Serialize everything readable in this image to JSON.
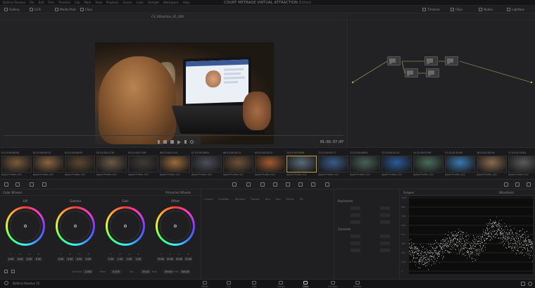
{
  "window": {
    "title": "COURT METRAGE VIRTUAL ATTRACTION",
    "title_suffix": "Edited"
  },
  "menu": [
    "DaVinci Resolve",
    "File",
    "Edit",
    "Trim",
    "Timeline",
    "Clip",
    "Mark",
    "View",
    "Playback",
    "Fusion",
    "Color",
    "Fairlight",
    "Workspace",
    "Help"
  ],
  "toolbar": {
    "left": [
      {
        "icon": "gallery-icon",
        "label": "Gallery"
      },
      {
        "icon": "luts-icon",
        "label": "LUTs"
      },
      {
        "icon": "media-pool-icon",
        "label": "Media Pool"
      },
      {
        "icon": "clips-icon",
        "label": "Clips"
      }
    ],
    "right": [
      {
        "icon": "timeline-icon",
        "label": "Timeline"
      },
      {
        "icon": "clips-icon",
        "label": "Clips"
      },
      {
        "icon": "nodes-icon",
        "label": "Nodes"
      },
      {
        "icon": "lightbox-icon",
        "label": "Lightbox"
      }
    ]
  },
  "viewer": {
    "clip_name": "CV_Attraction_01_004",
    "timecode": "01:02:37:07"
  },
  "nodes": [
    {
      "label": "01"
    },
    {
      "label": "02"
    },
    {
      "label": "03"
    },
    {
      "label": "04"
    },
    {
      "label": "05"
    }
  ],
  "clips": [
    {
      "num": "01",
      "tc": "01:00:00:00",
      "name": "Apple ProRes 422",
      "color": "#7a5a3a"
    },
    {
      "num": "02",
      "tc": "01:00:04:12",
      "name": "Apple ProRes 422",
      "color": "#8a6440"
    },
    {
      "num": "03",
      "tc": "01:00:09:03",
      "name": "Apple ProRes 422",
      "color": "#5a4530"
    },
    {
      "num": "04",
      "tc": "01:00:12:20",
      "name": "Apple ProRes 422",
      "color": "#6a5846"
    },
    {
      "num": "05",
      "tc": "01:00:17:08",
      "name": "Apple ProRes 422",
      "color": "#3e3a36"
    },
    {
      "num": "06",
      "tc": "01:00:21:15",
      "name": "Apple ProRes 422",
      "color": "#9a6a3c"
    },
    {
      "num": "07",
      "tc": "01:00:26:01",
      "name": "Apple ProRes 422",
      "color": "#4a4e58"
    },
    {
      "num": "08",
      "tc": "01:00:30:11",
      "name": "Apple ProRes 422",
      "color": "#6e5038"
    },
    {
      "num": "09",
      "tc": "01:00:34:22",
      "name": "Apple ProRes 422",
      "color": "#a05a30"
    },
    {
      "num": "10",
      "tc": "01:00:39:06",
      "name": "Apple ProRes 422",
      "color": "#5a6a7a"
    },
    {
      "num": "11",
      "tc": "01:00:43:17",
      "name": "Apple ProRes 422",
      "color": "#3a5a8a"
    },
    {
      "num": "12",
      "tc": "01:00:48:02",
      "name": "Apple ProRes 422",
      "color": "#486058"
    },
    {
      "num": "13",
      "tc": "01:00:52:14",
      "name": "Apple ProRes 422",
      "color": "#2a5a9a"
    },
    {
      "num": "14",
      "tc": "01:00:57:00",
      "name": "Apple ProRes 422",
      "color": "#4a6a5a"
    },
    {
      "num": "15",
      "tc": "01:01:01:09",
      "name": "Apple ProRes 422",
      "color": "#3a7ab0"
    },
    {
      "num": "16",
      "tc": "01:01:05:19",
      "name": "Apple ProRes 422",
      "color": "#8a6a50"
    },
    {
      "num": "17",
      "tc": "01:01:10:04",
      "name": "Apple ProRes 422",
      "color": "#5a5a5a"
    }
  ],
  "color_panel": {
    "title": "Color Wheels",
    "mode": "Primaries Wheels"
  },
  "wheels": [
    {
      "name": "Lift",
      "values": [
        "0.00",
        "0.00",
        "0.00",
        "0.00"
      ]
    },
    {
      "name": "Gamma",
      "values": [
        "0.00",
        "0.00",
        "0.00",
        "0.00"
      ]
    },
    {
      "name": "Gain",
      "values": [
        "1.00",
        "1.00",
        "1.00",
        "1.00"
      ]
    },
    {
      "name": "Offset",
      "values": [
        "25.00",
        "25.00",
        "25.00",
        "25.00"
      ]
    }
  ],
  "wheel_channels": [
    "Y",
    "R",
    "G",
    "B"
  ],
  "adjust": {
    "contrast_label": "Contrast",
    "contrast": "1.000",
    "pivot_label": "Pivot",
    "pivot": "0.435",
    "sat_label": "Sat",
    "sat": "50.00",
    "hue_label": "Hue",
    "hue": "50.00",
    "lum_label": "Lum Mix",
    "lum": "100.00"
  },
  "curves": {
    "tabs": [
      "Curves",
      "Qualifier",
      "Window",
      "Tracker",
      "Blur",
      "Key",
      "Sizing",
      "3D"
    ]
  },
  "keyframes": {
    "sections": [
      "Keyframes",
      "Corrector"
    ]
  },
  "scope": {
    "title": "Scopes",
    "mode": "Waveform",
    "ticks": [
      "1023",
      "896",
      "768",
      "640",
      "512",
      "384",
      "256",
      "128",
      "0"
    ]
  },
  "footer": {
    "app": "DaVinci Resolve 15",
    "pages": [
      {
        "label": "Media",
        "icon": "media-page-icon"
      },
      {
        "label": "Cut",
        "icon": "cut-page-icon"
      },
      {
        "label": "Edit",
        "icon": "edit-page-icon"
      },
      {
        "label": "Fusion",
        "icon": "fusion-page-icon"
      },
      {
        "label": "Color",
        "icon": "color-page-icon",
        "active": true
      },
      {
        "label": "Fairlight",
        "icon": "fairlight-page-icon"
      },
      {
        "label": "Deliver",
        "icon": "deliver-page-icon"
      }
    ]
  }
}
